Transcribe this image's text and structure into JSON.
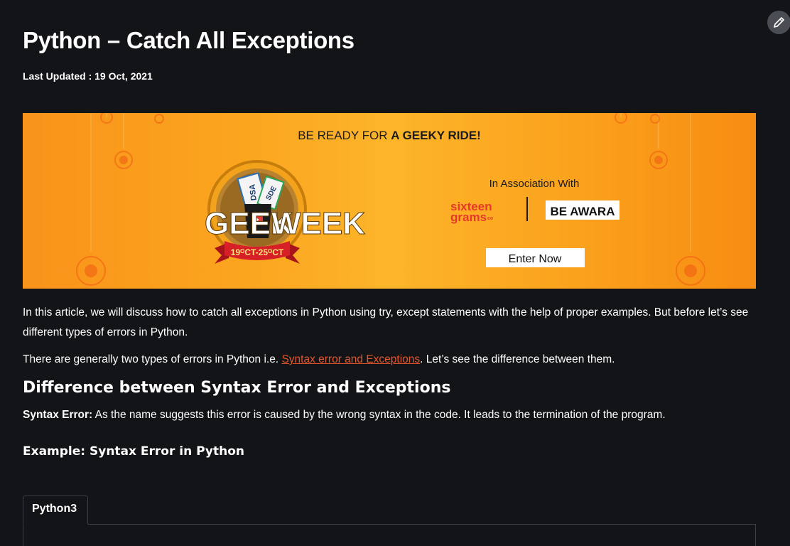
{
  "article": {
    "title": "Python – Catch All Exceptions",
    "last_updated": "Last Updated : 19 Oct, 2021",
    "intro": "In this article, we will discuss how to catch all exceptions in Python using try, except statements with the help of proper examples. But before let’s see different types of errors in Python.",
    "types_before": "There are generally two types of errors in Python i.e. ",
    "types_link": "Syntax error and Exceptions",
    "types_after": ". Let’s see the difference between them.",
    "heading_difference": "Difference between Syntax Error and Exceptions",
    "syntax_error_label": "Syntax Error:",
    "syntax_error_text": " As the name suggests this error is caused by the wrong syntax in the code. It leads to the termination of the program.",
    "example_heading": "Example: Syntax Error in Python",
    "code_tab": "Python3"
  },
  "banner": {
    "headline_prefix": "BE READY FOR ",
    "headline_bold": "A GEEKY RIDE!",
    "logo_left": "GEEK",
    "logo_right": "WEEK",
    "ribbon": "19ᴼCT-25ᴼCT",
    "ticket_1": "DSA",
    "ticket_2": "SDE",
    "association": "In Association With",
    "sponsor_1_line1": "sixteen",
    "sponsor_1_line2": "grams",
    "sponsor_1_suffix": "co",
    "sponsor_2": "BE AWARA",
    "cta": "Enter Now"
  },
  "icons": {
    "edit": "pencil-icon"
  },
  "colors": {
    "background": "#131417",
    "link": "#e0572d",
    "banner_orange": "#fba51f",
    "sponsor_red": "#e8382d"
  }
}
